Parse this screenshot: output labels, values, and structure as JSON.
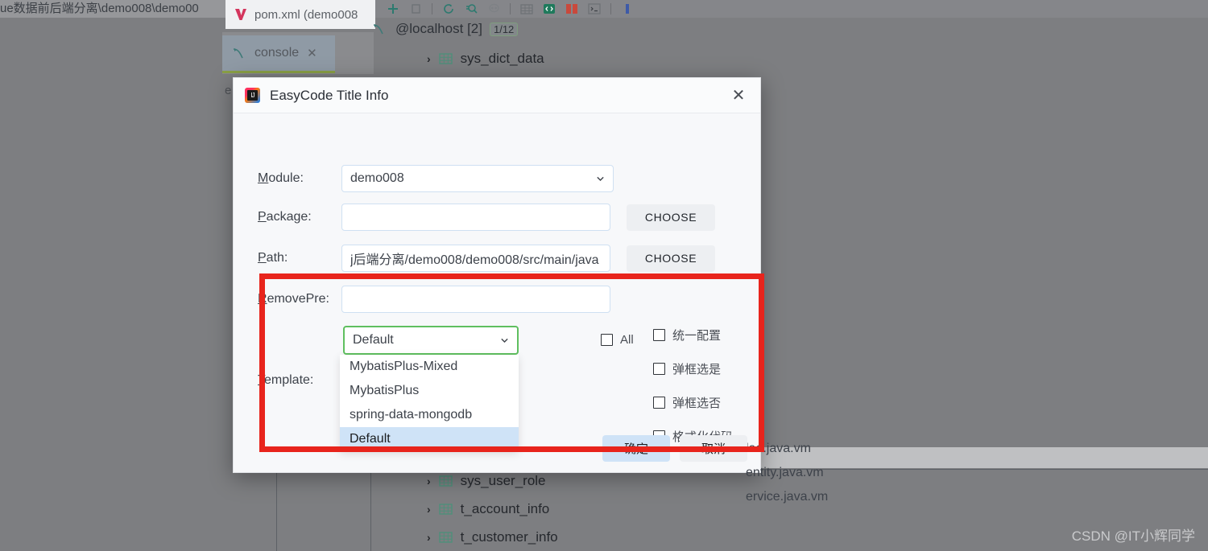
{
  "background": {
    "window_path": "ue数据前后端分离\\demo008\\demo00",
    "editor_tab": "pom.xml (demo008",
    "console_tab": "console",
    "close_x": "✕",
    "connection": "@localhost [2]",
    "connection_badge": "1/12",
    "tree_items": [
      {
        "name": "sys_dict_data",
        "chevron": "›"
      },
      {
        "name": "sys_user_role",
        "chevron": "›"
      },
      {
        "name": "t_account_info",
        "chevron": "›"
      },
      {
        "name": "t_customer_info",
        "chevron": "›"
      }
    ],
    "edge_letter": "e",
    "watermark": "CSDN @IT小辉同学",
    "toolbar_icons": [
      "add-icon",
      "duplicate-icon",
      "refresh-icon",
      "search-query-icon",
      "skull-icon",
      "table-icon",
      "code-editor-icon",
      "diff-icon",
      "terminal-icon",
      "filter-icon"
    ]
  },
  "dialog": {
    "title": "EasyCode Title Info",
    "close_label": "✕",
    "fields": {
      "module": {
        "label_prefix": "M",
        "label_rest": "odule:",
        "value": "demo008"
      },
      "package": {
        "label_prefix": "P",
        "label_rest": "ackage:",
        "value": "",
        "button": "CHOOSE"
      },
      "path": {
        "label_prefix": "P",
        "label_rest": "ath:",
        "value": "j后端分离/demo008/demo008/src/main/java",
        "button": "CHOOSE"
      },
      "remove_pre": {
        "label_prefix": "R",
        "label_rest": "emovePre:",
        "value": ""
      },
      "template": {
        "label_prefix": "T",
        "label_rest": "emplate:"
      }
    },
    "template_combo": {
      "value": "Default"
    },
    "template_options": [
      {
        "label": "MybatisPlus-Mixed",
        "selected": false
      },
      {
        "label": "MybatisPlus",
        "selected": false
      },
      {
        "label": "spring-data-mongodb",
        "selected": false
      },
      {
        "label": "Default",
        "selected": true
      }
    ],
    "vm_files": [
      "lao.java.vm",
      "entity.java.vm",
      "ervice.java.vm"
    ],
    "all_checkbox": {
      "label": "All",
      "checked": false
    },
    "options": [
      {
        "label": "统一配置",
        "checked": false
      },
      {
        "label": "弹框选是",
        "checked": false
      },
      {
        "label": "弹框选否",
        "checked": false
      },
      {
        "label": "格式化代码",
        "checked": false
      }
    ],
    "footer": {
      "ok": "确定",
      "cancel": "取消"
    }
  },
  "annotation": {
    "color": "#e8241c"
  }
}
